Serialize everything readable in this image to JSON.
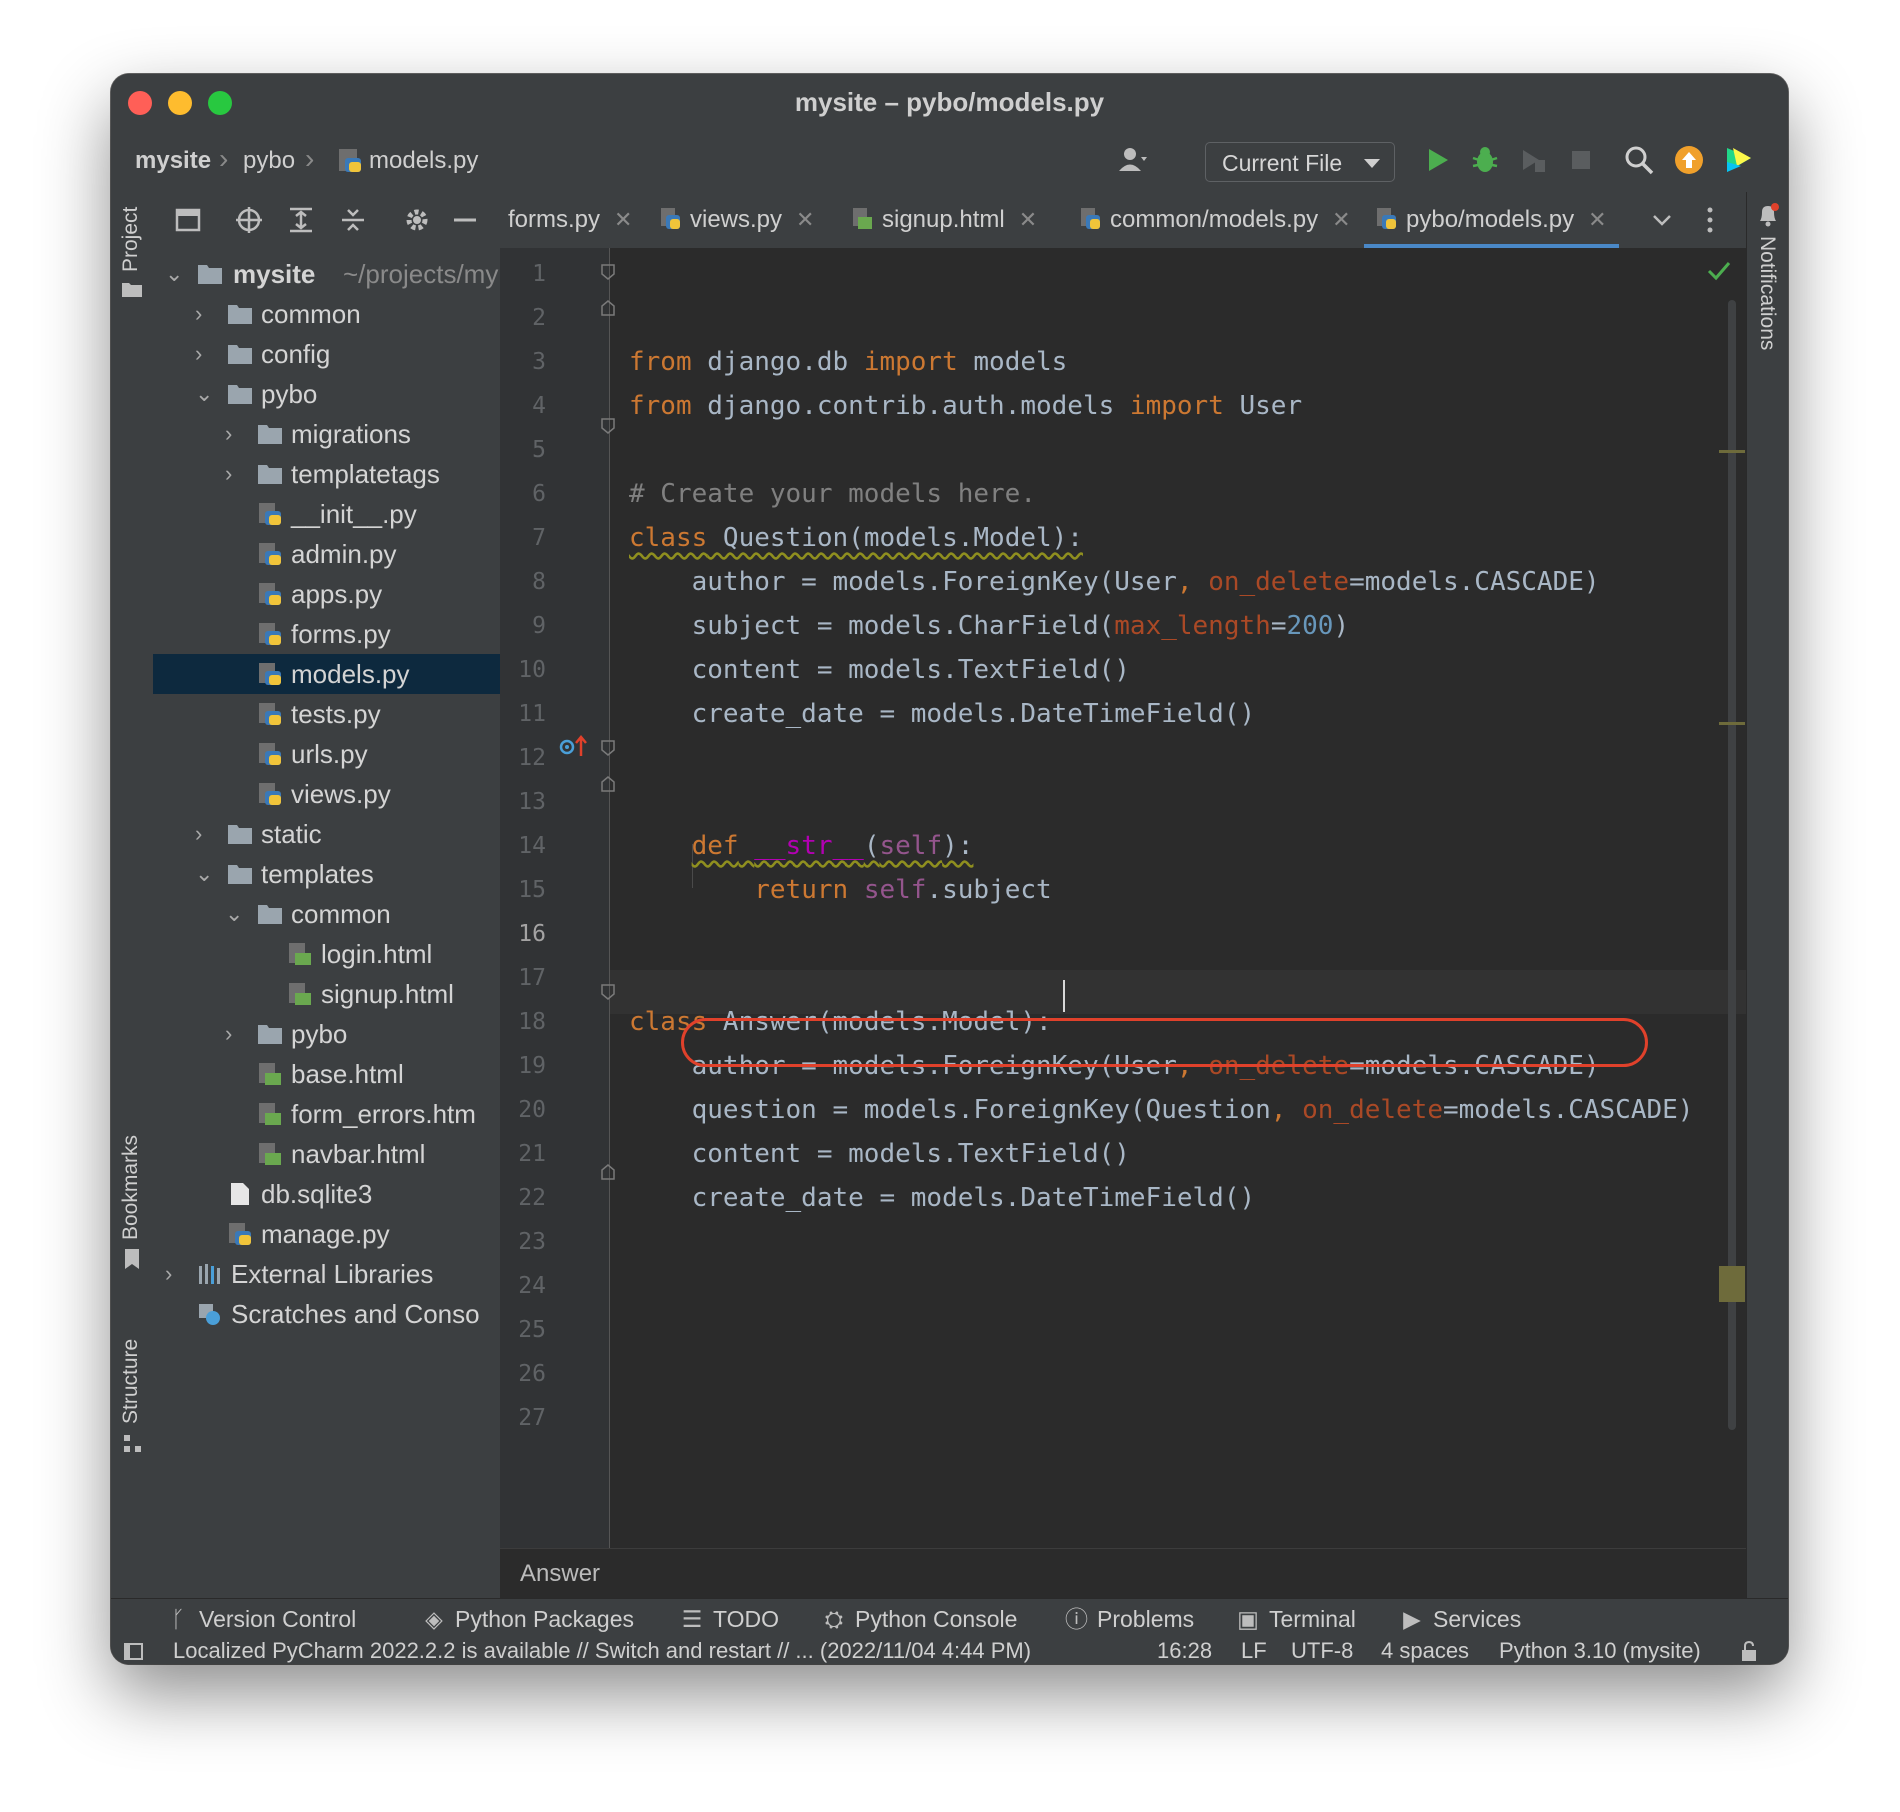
{
  "window": {
    "title": "mysite – pybo/models.py"
  },
  "navbar": {
    "crumbs": [
      "mysite",
      "pybo",
      "models.py"
    ],
    "run_config": "Current File"
  },
  "left_stripe": {
    "project": "Project",
    "bookmarks": "Bookmarks",
    "structure": "Structure"
  },
  "right_stripe": {
    "notifications": "Notifications"
  },
  "project_tree": {
    "root_name": "mysite",
    "root_path": "~/projects/my",
    "items": [
      {
        "label": "common",
        "kind": "folder",
        "expanded": false
      },
      {
        "label": "config",
        "kind": "folder",
        "expanded": false
      },
      {
        "label": "pybo",
        "kind": "folder",
        "expanded": true
      },
      {
        "label": "migrations",
        "kind": "folder",
        "expanded": false
      },
      {
        "label": "templatetags",
        "kind": "folder",
        "expanded": false
      },
      {
        "label": "__init__.py",
        "kind": "python-file"
      },
      {
        "label": "admin.py",
        "kind": "python-file"
      },
      {
        "label": "apps.py",
        "kind": "python-file"
      },
      {
        "label": "forms.py",
        "kind": "python-file"
      },
      {
        "label": "models.py",
        "kind": "python-file",
        "selected": true
      },
      {
        "label": "tests.py",
        "kind": "python-file"
      },
      {
        "label": "urls.py",
        "kind": "python-file"
      },
      {
        "label": "views.py",
        "kind": "python-file"
      },
      {
        "label": "static",
        "kind": "folder",
        "expanded": false
      },
      {
        "label": "templates",
        "kind": "folder",
        "expanded": true
      },
      {
        "label": "common",
        "kind": "folder",
        "expanded": true
      },
      {
        "label": "login.html",
        "kind": "html-file"
      },
      {
        "label": "signup.html",
        "kind": "html-file"
      },
      {
        "label": "pybo",
        "kind": "folder",
        "expanded": false
      },
      {
        "label": "base.html",
        "kind": "html-file"
      },
      {
        "label": "form_errors.htm",
        "kind": "html-file"
      },
      {
        "label": "navbar.html",
        "kind": "html-file"
      },
      {
        "label": "db.sqlite3",
        "kind": "file"
      },
      {
        "label": "manage.py",
        "kind": "python-file"
      },
      {
        "label": "External Libraries",
        "kind": "libraries",
        "expanded": false
      },
      {
        "label": "Scratches and Conso",
        "kind": "scratches"
      }
    ]
  },
  "tabs": [
    {
      "label": "forms.py",
      "active": false
    },
    {
      "label": "views.py",
      "active": false
    },
    {
      "label": "signup.html",
      "active": false
    },
    {
      "label": "common/models.py",
      "active": false
    },
    {
      "label": "pybo/models.py",
      "active": true
    }
  ],
  "editor": {
    "line_numbers": [
      "1",
      "2",
      "3",
      "4",
      "5",
      "6",
      "7",
      "8",
      "9",
      "10",
      "11",
      "12",
      "13",
      "14",
      "15",
      "16",
      "17",
      "18",
      "19",
      "20",
      "21",
      "22",
      "23",
      "24",
      "25",
      "26",
      "27"
    ],
    "current_line": "16",
    "highlighted_line": "17",
    "breadcrumb": "Answer"
  },
  "bottom_tabs": [
    {
      "label": "Version Control",
      "icon": "branch-icon"
    },
    {
      "label": "Python Packages",
      "icon": "layers-icon"
    },
    {
      "label": "TODO",
      "icon": "list-icon"
    },
    {
      "label": "Python Console",
      "icon": "python-icon"
    },
    {
      "label": "Problems",
      "icon": "info-icon"
    },
    {
      "label": "Terminal",
      "icon": "terminal-icon"
    },
    {
      "label": "Services",
      "icon": "services-icon"
    }
  ],
  "statusbar": {
    "message": "Localized PyCharm 2022.2.2 is available // Switch and restart // ... (2022/11/04 4:44 PM)",
    "position": "16:28",
    "line_sep": "LF",
    "encoding": "UTF-8",
    "indent": "4 spaces",
    "interpreter": "Python 3.10 (mysite)"
  },
  "colors": {
    "keyword": "#cc7832",
    "comment": "#808080",
    "number": "#6897bb",
    "kwarg": "#aa4926",
    "self": "#94558d",
    "highlight_oval": "#e0412b",
    "active_tab_underline": "#4a88c7"
  }
}
